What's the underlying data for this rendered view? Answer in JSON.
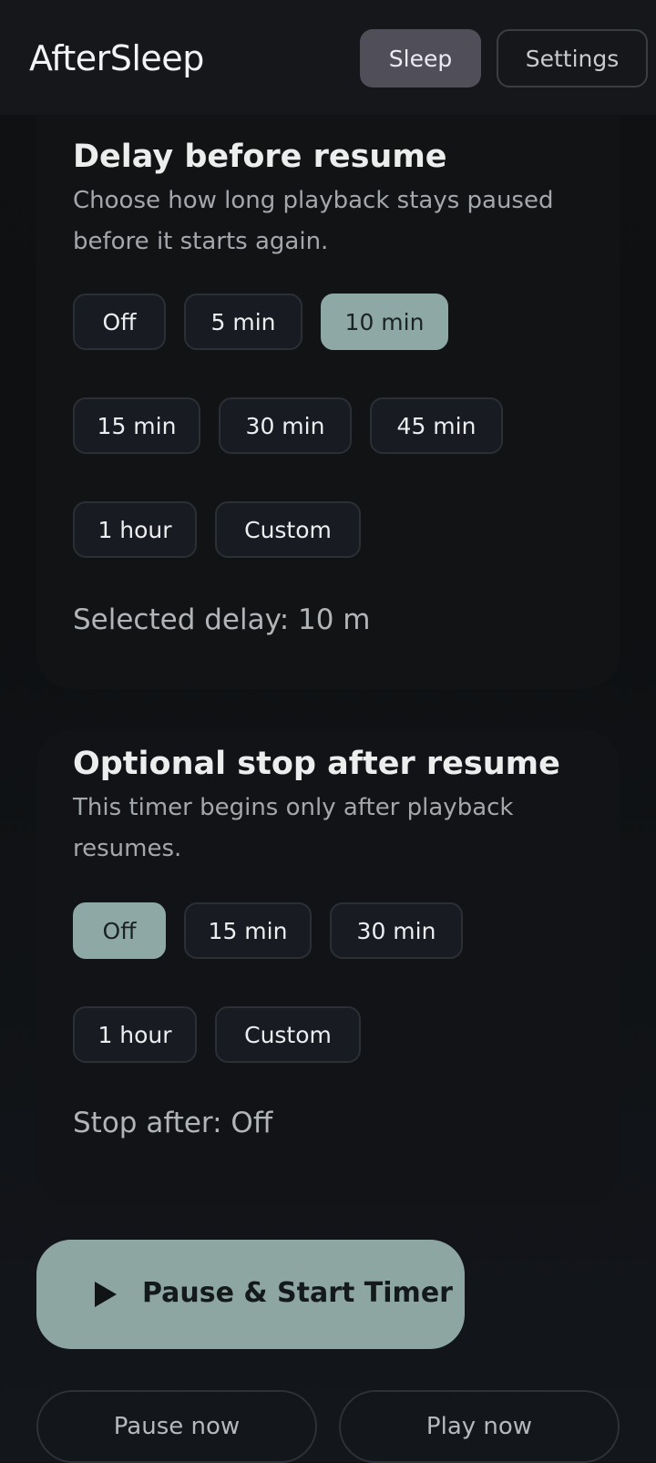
{
  "app": {
    "title": "AfterSleep"
  },
  "nav": {
    "sleep_label": "Sleep",
    "settings_label": "Settings"
  },
  "delay": {
    "title": "Delay before resume",
    "description": "Choose how long playback stays paused before it starts again.",
    "options": [
      "Off",
      "5 min",
      "10 min",
      "15 min",
      "30 min",
      "45 min",
      "1 hour",
      "Custom"
    ],
    "selected": "10 min",
    "summary": "Selected delay: 10 m"
  },
  "stop": {
    "title": "Optional stop after resume",
    "description": "This timer begins only after playback resumes.",
    "options": [
      "Off",
      "15 min",
      "30 min",
      "1 hour",
      "Custom"
    ],
    "selected": "Off",
    "summary": "Stop after: Off"
  },
  "actions": {
    "primary_label": "Pause & Start Timer",
    "primary_icon": "play-icon",
    "pause_now_label": "Pause now",
    "play_now_label": "Play now"
  },
  "colors": {
    "accent": "#8ea9a5",
    "nav_active": "#4f4e59",
    "background": "#0f1113"
  }
}
